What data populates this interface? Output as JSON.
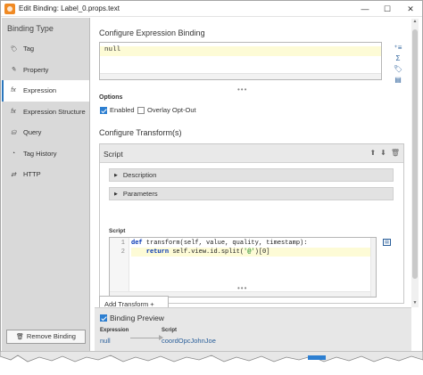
{
  "window": {
    "title": "Edit Binding: Label_0.props.text",
    "minimize": "—",
    "maximize": "☐",
    "close": "✕"
  },
  "sidebar": {
    "heading": "Binding Type",
    "items": [
      {
        "label": "Tag",
        "icon": "tag-icon",
        "glyph": "🏷",
        "active": false
      },
      {
        "label": "Property",
        "icon": "property-icon",
        "glyph": "✎",
        "active": false
      },
      {
        "label": "Expression",
        "icon": "fx-icon",
        "glyph": "fx",
        "active": true
      },
      {
        "label": "Expression Structure",
        "icon": "fx-icon",
        "glyph": "fx",
        "active": false
      },
      {
        "label": "Query",
        "icon": "database-icon",
        "glyph": "⛁",
        "active": false
      },
      {
        "label": "Tag History",
        "icon": "history-icon",
        "glyph": "◔",
        "active": false
      },
      {
        "label": "HTTP",
        "icon": "http-icon",
        "glyph": "⇄",
        "active": false
      }
    ],
    "remove_button": "Remove Binding"
  },
  "expression": {
    "heading": "Configure Expression Binding",
    "value": "null"
  },
  "options": {
    "heading": "Options",
    "enabled_label": "Enabled",
    "enabled_checked": true,
    "overlay_label": "Overlay Opt-Out",
    "overlay_checked": false
  },
  "transforms": {
    "heading": "Configure Transform(s)",
    "panel_title": "Script",
    "description_label": "Description",
    "parameters_label": "Parameters",
    "script_label": "Script",
    "line_numbers": [
      "1",
      "2"
    ],
    "code_def": "def",
    "code_sig": " transform(self, value, quality, timestamp):",
    "code_return": "return",
    "code_body_a": " self.view.id.split(",
    "code_str": "'@'",
    "code_body_b": ")[0]",
    "add_button": "Add Transform +"
  },
  "preview": {
    "label": "Binding Preview",
    "checked": true,
    "expression_label": "Expression",
    "expression_value": "null",
    "script_label": "Script",
    "script_value": "coordOpcJohnJoe"
  },
  "colors": {
    "accent": "#2d7fd1",
    "link": "#2a5f9a",
    "highlight": "#fdfbd6",
    "sidebar_bg": "#d9d9d9"
  }
}
